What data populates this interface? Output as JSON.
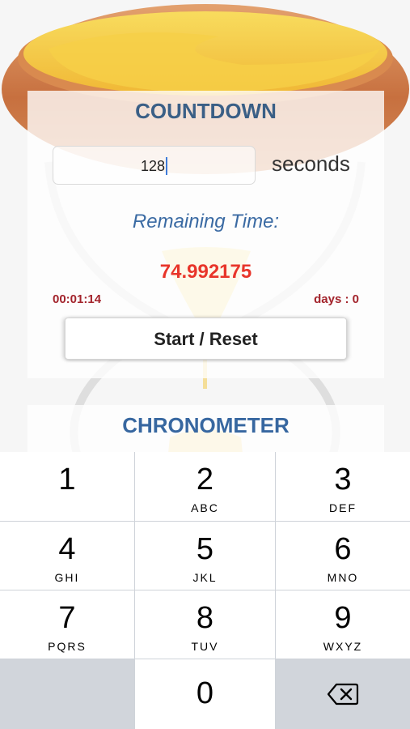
{
  "countdown": {
    "title": "COUNTDOWN",
    "input_value": "128",
    "unit_label": "seconds",
    "remaining_label": "Remaining Time:",
    "remaining_value": "74.992175",
    "elapsed_hms": "00:01:14",
    "days_label": "days : 0",
    "start_reset_label": "Start / Reset"
  },
  "chronometer": {
    "title": "CHRONOMETER"
  },
  "keypad": {
    "keys": [
      {
        "num": "1",
        "letters": ""
      },
      {
        "num": "2",
        "letters": "ABC"
      },
      {
        "num": "3",
        "letters": "DEF"
      },
      {
        "num": "4",
        "letters": "GHI"
      },
      {
        "num": "5",
        "letters": "JKL"
      },
      {
        "num": "6",
        "letters": "MNO"
      },
      {
        "num": "7",
        "letters": "PQRS"
      },
      {
        "num": "8",
        "letters": "TUV"
      },
      {
        "num": "9",
        "letters": "WXYZ"
      },
      {
        "num": "0",
        "letters": ""
      }
    ],
    "delete_icon": "backspace-icon"
  },
  "colors": {
    "title_blue": "#3a5f86",
    "remaining_red": "#e8352a",
    "dark_red": "#a3242c",
    "hourglass_amber": "#f3c441",
    "hourglass_rim": "#c9754a"
  }
}
